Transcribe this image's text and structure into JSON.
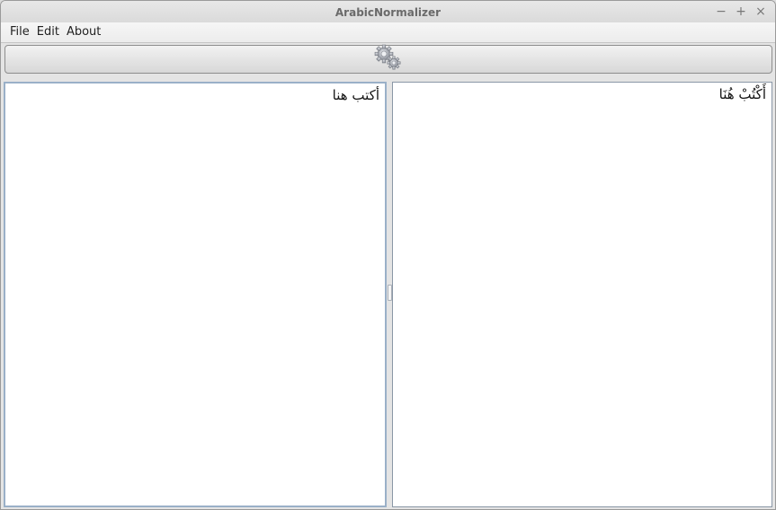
{
  "window": {
    "title": "ArabicNormalizer",
    "controls": {
      "minimize": "−",
      "maximize": "+",
      "close": "×"
    }
  },
  "menubar": {
    "items": [
      {
        "label": "File"
      },
      {
        "label": "Edit"
      },
      {
        "label": "About"
      }
    ]
  },
  "toolbar": {
    "normalize_button_icon": "gears-icon"
  },
  "editor": {
    "input_text": "أكتب هنا",
    "output_text": "أَكْتُبْ هُنَا"
  }
}
